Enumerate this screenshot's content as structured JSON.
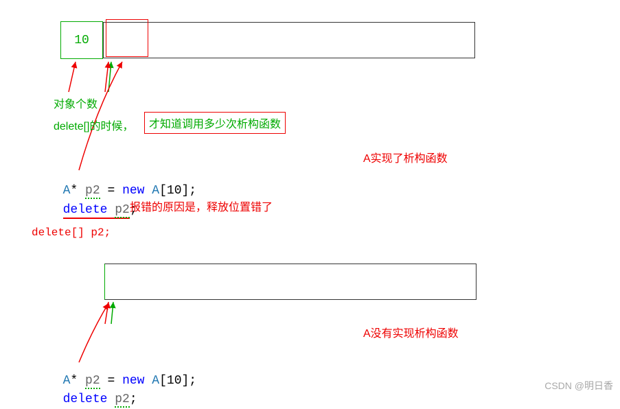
{
  "top": {
    "count_value": "10",
    "count_label": "对象个数",
    "delete_text": "delete[]的时候，",
    "destructor_note": "才知道调用多少次析构函数",
    "right_note": "A实现了析构函数",
    "error_reason": "报错的原因是，释放位置错了",
    "delete_arr": "delete[] p2;"
  },
  "code1": {
    "line1_type": "A",
    "line1_star": "*",
    "line1_var": "p2",
    "line1_eq": " = ",
    "line1_new": "new",
    "line1_sp": " ",
    "line1_cls": "A",
    "line1_br": "[10];",
    "line2_delete": "delete",
    "line2_sp": " ",
    "line2_var": "p2",
    "line2_semi": ";"
  },
  "bottom": {
    "right_note": "A没有实现析构函数"
  },
  "code2": {
    "line1_type": "A",
    "line1_star": "*",
    "line1_var": "p2",
    "line1_eq": " = ",
    "line1_new": "new",
    "line1_sp": " ",
    "line1_cls": "A",
    "line1_br": "[10];",
    "line2_delete": "delete",
    "line2_sp": " ",
    "line2_var": "p2",
    "line2_semi": ";"
  },
  "watermark": "CSDN @明日香"
}
